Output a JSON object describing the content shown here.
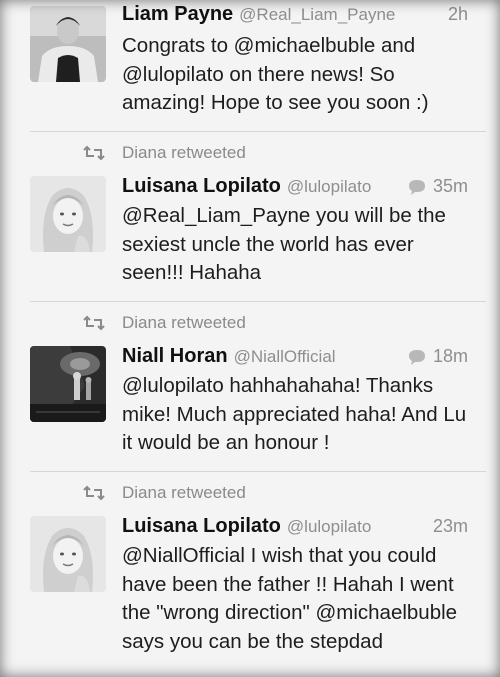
{
  "tweets": [
    {
      "name": "Liam Payne",
      "handle": "@Real_Liam_Payne",
      "time": "2h",
      "text": "Congrats to @michaelbuble and @lulopilato on there news! So amazing! Hope to see you soon :)",
      "retweeted_by": null,
      "has_reply_icon": false,
      "avatar": "liam-avatar"
    },
    {
      "name": "Luisana Lopilato",
      "handle": "@lulopilato",
      "time": "35m",
      "text": "@Real_Liam_Payne you will be the sexiest uncle the world has ever seen!!! Hahaha",
      "retweeted_by": "Diana retweeted",
      "has_reply_icon": true,
      "avatar": "luisana-avatar"
    },
    {
      "name": "Niall Horan",
      "handle": "@NiallOfficial",
      "time": "18m",
      "text": "@lulopilato hahhahahaha! Thanks mike! Much appreciated haha! And Lu it would be an honour !",
      "retweeted_by": "Diana retweeted",
      "has_reply_icon": true,
      "avatar": "niall-avatar"
    },
    {
      "name": "Luisana Lopilato",
      "handle": "@lulopilato",
      "time": "23m",
      "text": "@NiallOfficial I wish that you could have been the father !! Hahah  I went the \"wrong direction\" @michaelbuble  says you can be the stepdad",
      "retweeted_by": "Diana retweeted",
      "has_reply_icon": false,
      "avatar": "luisana-avatar"
    }
  ]
}
